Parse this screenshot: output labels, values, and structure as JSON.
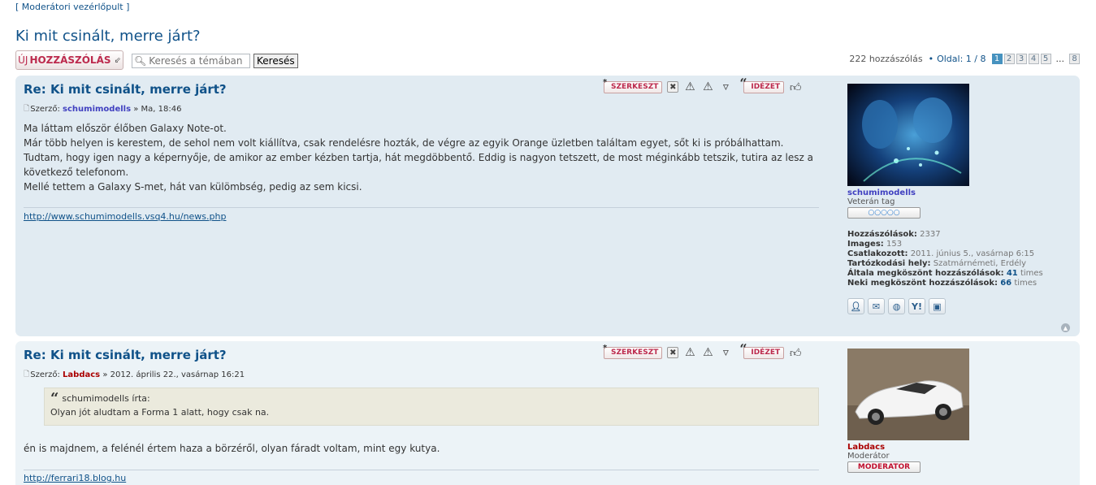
{
  "header": {
    "mod_panel": "[ Moderátori vezérlőpult ]",
    "topic_title": "Ki mit csinált, merre járt?"
  },
  "action_bar": {
    "reply_prefix": "ÚJ ",
    "reply_label": "HOZZÁSZÓLÁS",
    "search_placeholder": "Keresés a témában",
    "search_button": "Keresés",
    "post_count": "222 hozzászólás",
    "page_label": "Oldal: 1 / 8",
    "pages": [
      "1",
      "2",
      "3",
      "4",
      "5"
    ],
    "ellipsis": "...",
    "last_page": "8"
  },
  "post_buttons": {
    "edit": "SZERKESZT",
    "quote": "IDÉZET"
  },
  "posts": [
    {
      "title": "Re: Ki mit csinált, merre járt?",
      "author_prefix": "Szerző:",
      "author": "schumimodells",
      "date": "» Ma, 18:46",
      "lines": [
        "Ma láttam először élőben Galaxy Note-ot.",
        "Már több helyen is kerestem, de sehol nem volt kiállítva, csak rendelésre hozták, de végre az egyik Orange üzletben találtam egyet, sőt ki is próbálhattam.",
        "Tudtam, hogy igen nagy a képernyője, de amikor az ember kézben tartja, hát megdöbbentő. Eddig is nagyon tetszett, de most méginkább tetszik, tutira az lesz a",
        "következő telefonom.",
        "Mellé tettem a Galaxy S-met, hát van külömbség, pedig az sem kicsi."
      ],
      "signature": "http://www.schumimodells.vsq4.hu/news.php",
      "profile": {
        "name": "schumimodells",
        "rank": "Veterán tag",
        "rank_bar": "○○○○○",
        "stats": [
          {
            "k": "Hozzászólások:",
            "v": "2337"
          },
          {
            "k": "Images:",
            "v": "153"
          },
          {
            "k": "Csatlakozott:",
            "v": "2011. június 5., vasárnap 6:15"
          },
          {
            "k": "Tartózkodási hely:",
            "v": "Szatmárnémeti, Erdély"
          }
        ],
        "thanked_by_label": "Általa megköszönt hozzászólások:",
        "thanked_by_count": "41",
        "thanked_label": "Neki megköszönt hozzászólások:",
        "thanked_count": "66",
        "times": "times"
      }
    },
    {
      "title": "Re: Ki mit csinált, merre járt?",
      "author_prefix": "Szerző:",
      "author": "Labdacs",
      "date": "» 2012. április 22., vasárnap 16:21",
      "quote_author": "schumimodells írta:",
      "quote_text": "Olyan jót aludtam a Forma 1 alatt, hogy csak na.",
      "line": "én is majdnem, a felénél értem haza a börzéről, olyan fáradt voltam, mint egy kutya.",
      "signature": "http://ferrari18.blog.hu",
      "profile": {
        "name": "Labdacs",
        "rank": "Moderátor",
        "rank_bar": "MODERATOR"
      }
    }
  ],
  "colors": {
    "link": "#105289",
    "post_bg1": "#e1ebf2",
    "post_bg2": "#ecf3f7",
    "button_red": "#bc2a4d"
  }
}
